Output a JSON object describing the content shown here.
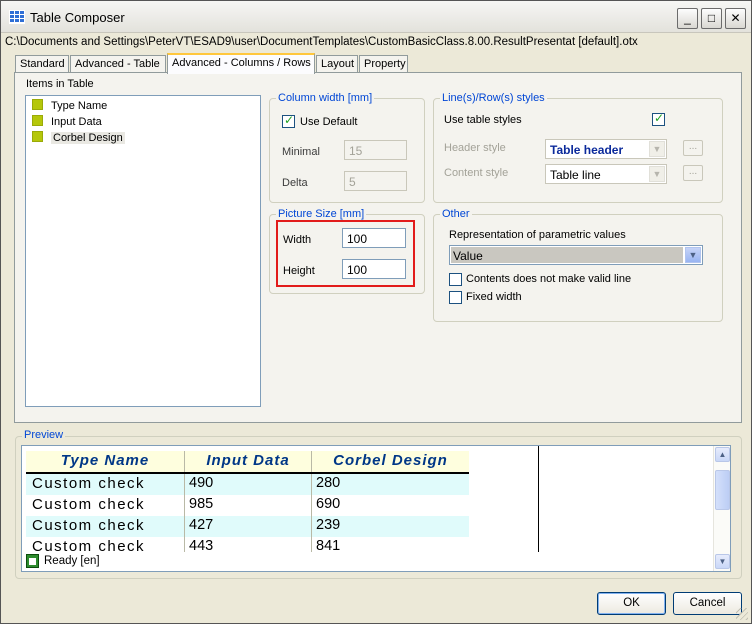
{
  "window": {
    "title": "Table Composer",
    "path": "C:\\Documents and Settings\\PeterVT\\ESAD9\\user\\DocumentTemplates\\CustomBasicClass.8.00.ResultPresentat [default].otx"
  },
  "titlebar_buttons": {
    "minimize": "_",
    "maximize": "□",
    "close": "✕"
  },
  "tabs": [
    {
      "label": "Standard"
    },
    {
      "label": "Advanced - Table"
    },
    {
      "label": "Advanced - Columns / Rows",
      "active": true
    },
    {
      "label": "Layout"
    },
    {
      "label": "Property"
    }
  ],
  "items_in_table": {
    "label": "Items in Table",
    "items": [
      "Type Name",
      "Input Data",
      "Corbel Design"
    ],
    "selected": "Corbel Design"
  },
  "column_width": {
    "title": "Column width [mm]",
    "use_default_label": "Use Default",
    "use_default_checked": true,
    "minimal_label": "Minimal",
    "minimal_value": "15",
    "delta_label": "Delta",
    "delta_value": "5"
  },
  "line_styles": {
    "title": "Line(s)/Row(s) styles",
    "use_table_styles_label": "Use table styles",
    "use_table_styles_checked": true,
    "header_style_label": "Header style",
    "header_style_value": "Table header",
    "content_style_label": "Content style",
    "content_style_value": "Table line",
    "more_button": "..."
  },
  "picture_size": {
    "title": "Picture Size [mm]",
    "width_label": "Width",
    "width_value": "100",
    "height_label": "Height",
    "height_value": "100"
  },
  "other": {
    "title": "Other",
    "representation_label": "Representation of parametric values",
    "representation_value": "Value",
    "contents_label": "Contents does not make valid line",
    "contents_checked": false,
    "fixed_width_label": "Fixed width",
    "fixed_width_checked": false
  },
  "preview": {
    "title": "Preview",
    "headers": [
      "Type Name",
      "Input Data",
      "Corbel Design"
    ],
    "rows": [
      [
        "Custom check",
        "490",
        "280"
      ],
      [
        "Custom check",
        "985",
        "690"
      ],
      [
        "Custom check",
        "427",
        "239"
      ],
      [
        "Custom check",
        "443",
        "841"
      ]
    ],
    "status": "Ready [en]"
  },
  "buttons": {
    "ok": "OK",
    "cancel": "Cancel"
  },
  "colors": {
    "accent_blue": "#0046d5",
    "highlight_red": "#e21b1b",
    "header_text": "#003787"
  }
}
